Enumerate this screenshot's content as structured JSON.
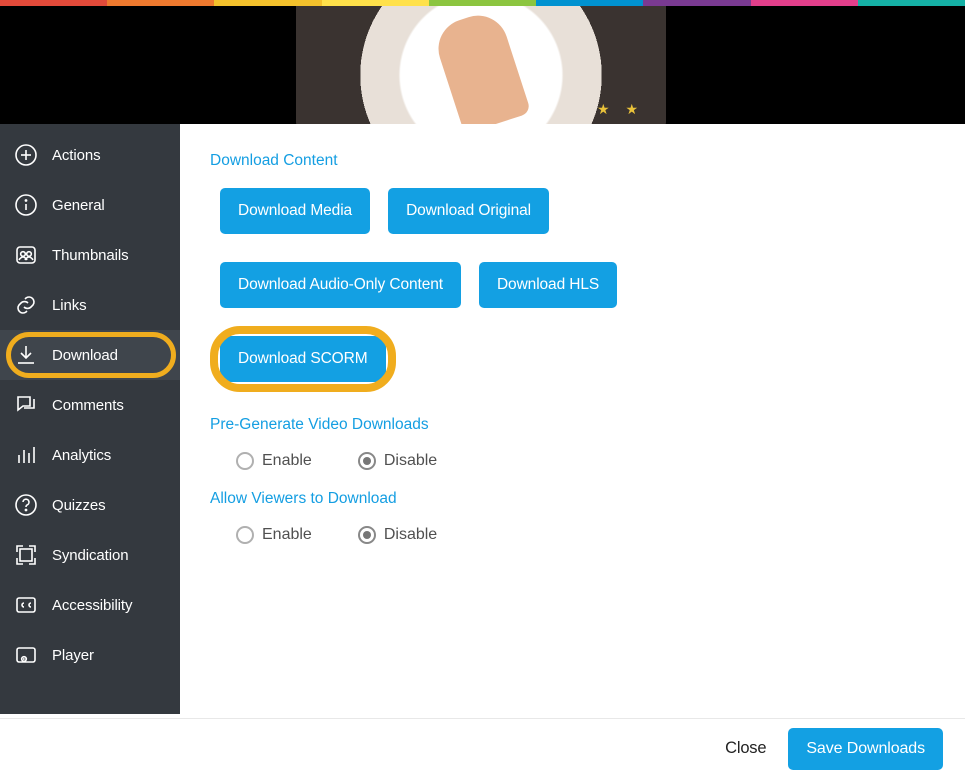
{
  "rainbow_colors": [
    "#e24a3a",
    "#ef7a2f",
    "#f4c22c",
    "#ffe14a",
    "#8cc540",
    "#0092d0",
    "#7a3a92",
    "#e23f8b",
    "#15b1a6"
  ],
  "close_x": "✕",
  "sidebar": {
    "items": [
      {
        "icon": "plus-circle-icon",
        "label": "Actions"
      },
      {
        "icon": "info-circle-icon",
        "label": "General"
      },
      {
        "icon": "people-icon",
        "label": "Thumbnails"
      },
      {
        "icon": "link-icon",
        "label": "Links"
      },
      {
        "icon": "download-icon",
        "label": "Download",
        "active": true,
        "highlighted": true
      },
      {
        "icon": "comments-icon",
        "label": "Comments"
      },
      {
        "icon": "analytics-icon",
        "label": "Analytics"
      },
      {
        "icon": "quiz-icon",
        "label": "Quizzes"
      },
      {
        "icon": "syndication-icon",
        "label": "Syndication"
      },
      {
        "icon": "cc-icon",
        "label": "Accessibility"
      },
      {
        "icon": "player-icon",
        "label": "Player"
      }
    ]
  },
  "sections": {
    "download_content": {
      "title": "Download Content",
      "buttons": [
        {
          "label": "Download Media"
        },
        {
          "label": "Download Original"
        },
        {
          "label": "Download Audio-Only Content"
        },
        {
          "label": "Download HLS"
        },
        {
          "label": "Download SCORM",
          "highlighted": true
        }
      ]
    },
    "pre_generate": {
      "title": "Pre-Generate Video Downloads",
      "enable": "Enable",
      "disable": "Disable",
      "value": "disable"
    },
    "allow_viewers": {
      "title": "Allow Viewers to Download",
      "enable": "Enable",
      "disable": "Disable",
      "value": "disable"
    }
  },
  "footer": {
    "close": "Close",
    "save": "Save Downloads"
  }
}
